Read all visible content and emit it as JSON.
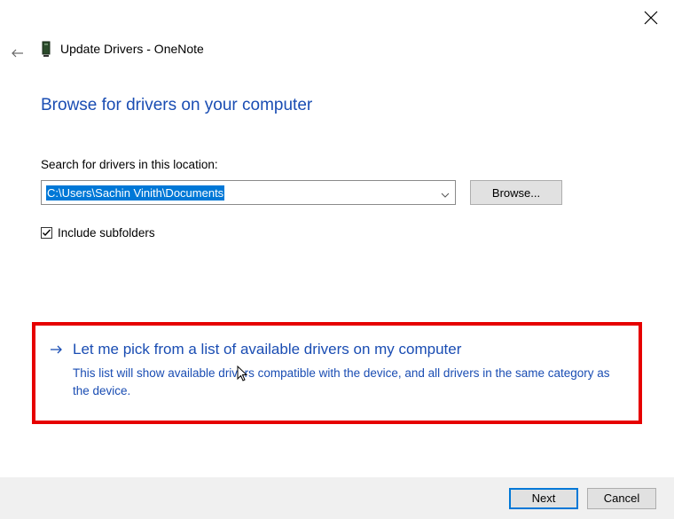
{
  "window": {
    "title": "Update Drivers - OneNote"
  },
  "heading": "Browse for drivers on your computer",
  "search": {
    "label": "Search for drivers in this location:",
    "value": "C:\\Users\\Sachin Vinith\\Documents",
    "browse_label": "Browse..."
  },
  "checkbox": {
    "checked": true,
    "label": "Include subfolders"
  },
  "pick": {
    "heading": "Let me pick from a list of available drivers on my computer",
    "description": "This list will show available drivers compatible with the device, and all drivers in the same category as the device."
  },
  "footer": {
    "next": "Next",
    "cancel": "Cancel"
  },
  "colors": {
    "accent": "#0078d7",
    "link": "#1a4db3",
    "highlight": "#e60000"
  }
}
